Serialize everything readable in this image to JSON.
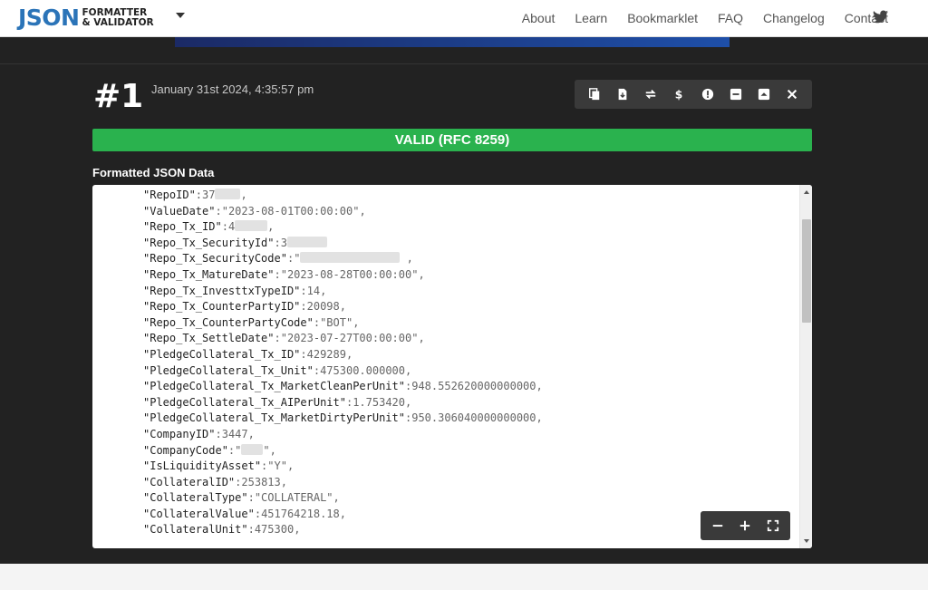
{
  "header": {
    "logo_main": "JSON",
    "logo_line1": "FORMATTER",
    "logo_line2": "& VALIDATOR",
    "nav": [
      "About",
      "Learn",
      "Bookmarklet",
      "FAQ",
      "Changelog",
      "Contact"
    ]
  },
  "entry": {
    "number": "#1",
    "timestamp": "January 31st 2024, 4:35:57 pm",
    "status": "VALID (RFC 8259)",
    "section_label": "Formatted JSON Data"
  },
  "toolbar_icons": [
    "copy-icon",
    "download-icon",
    "transform-icon",
    "dollar-icon",
    "alert-icon",
    "collapse-icon",
    "expand-icon",
    "close-icon"
  ],
  "zoom_icons": [
    "zoom-out-icon",
    "zoom-in-icon",
    "fullscreen-icon"
  ],
  "colors": {
    "valid": "#2ab24e",
    "brand": "#2b74b8",
    "dark_bg": "#222222"
  },
  "json_lines": [
    {
      "key": "\"RepoID\"",
      "value": "37",
      "redact": 28,
      "after": ","
    },
    {
      "key": "\"ValueDate\"",
      "value": "\"2023-08-01T00:00:00\"",
      "after": ","
    },
    {
      "key": "\"Repo_Tx_ID\"",
      "value": "4",
      "redact": 36,
      "after": ","
    },
    {
      "key": "\"Repo_Tx_SecurityId\"",
      "value": "3",
      "redact": 44,
      "after": ""
    },
    {
      "key": "\"Repo_Tx_SecurityCode\"",
      "value": "\"",
      "redact": 110,
      "after": " ,"
    },
    {
      "key": "\"Repo_Tx_MatureDate\"",
      "value": "\"2023-08-28T00:00:00\"",
      "after": ","
    },
    {
      "key": "\"Repo_Tx_InvesttxTypeID\"",
      "value": "14",
      "after": ","
    },
    {
      "key": "\"Repo_Tx_CounterPartyID\"",
      "value": "20098",
      "after": ","
    },
    {
      "key": "\"Repo_Tx_CounterPartyCode\"",
      "value": "\"BOT\"",
      "after": ","
    },
    {
      "key": "\"Repo_Tx_SettleDate\"",
      "value": "\"2023-07-27T00:00:00\"",
      "after": ","
    },
    {
      "key": "\"PledgeCollateral_Tx_ID\"",
      "value": "429289",
      "after": ","
    },
    {
      "key": "\"PledgeCollateral_Tx_Unit\"",
      "value": "475300.000000",
      "after": ","
    },
    {
      "key": "\"PledgeCollateral_Tx_MarketCleanPerUnit\"",
      "value": "948.552620000000000",
      "after": ","
    },
    {
      "key": "\"PledgeCollateral_Tx_AIPerUnit\"",
      "value": "1.753420",
      "after": ","
    },
    {
      "key": "\"PledgeCollateral_Tx_MarketDirtyPerUnit\"",
      "value": "950.306040000000000",
      "after": ","
    },
    {
      "key": "\"CompanyID\"",
      "value": "3447",
      "after": ","
    },
    {
      "key": "\"CompanyCode\"",
      "value": "\"",
      "redact": 24,
      "after": "\","
    },
    {
      "key": "\"IsLiquidityAsset\"",
      "value": "\"Y\"",
      "after": ","
    },
    {
      "key": "\"CollateralID\"",
      "value": "253813",
      "after": ","
    },
    {
      "key": "\"CollateralType\"",
      "value": "\"COLLATERAL\"",
      "after": ","
    },
    {
      "key": "\"CollateralValue\"",
      "value": "451764218.18",
      "after": ","
    },
    {
      "key": "\"CollateralUnit\"",
      "value": "475300",
      "after": ","
    }
  ]
}
